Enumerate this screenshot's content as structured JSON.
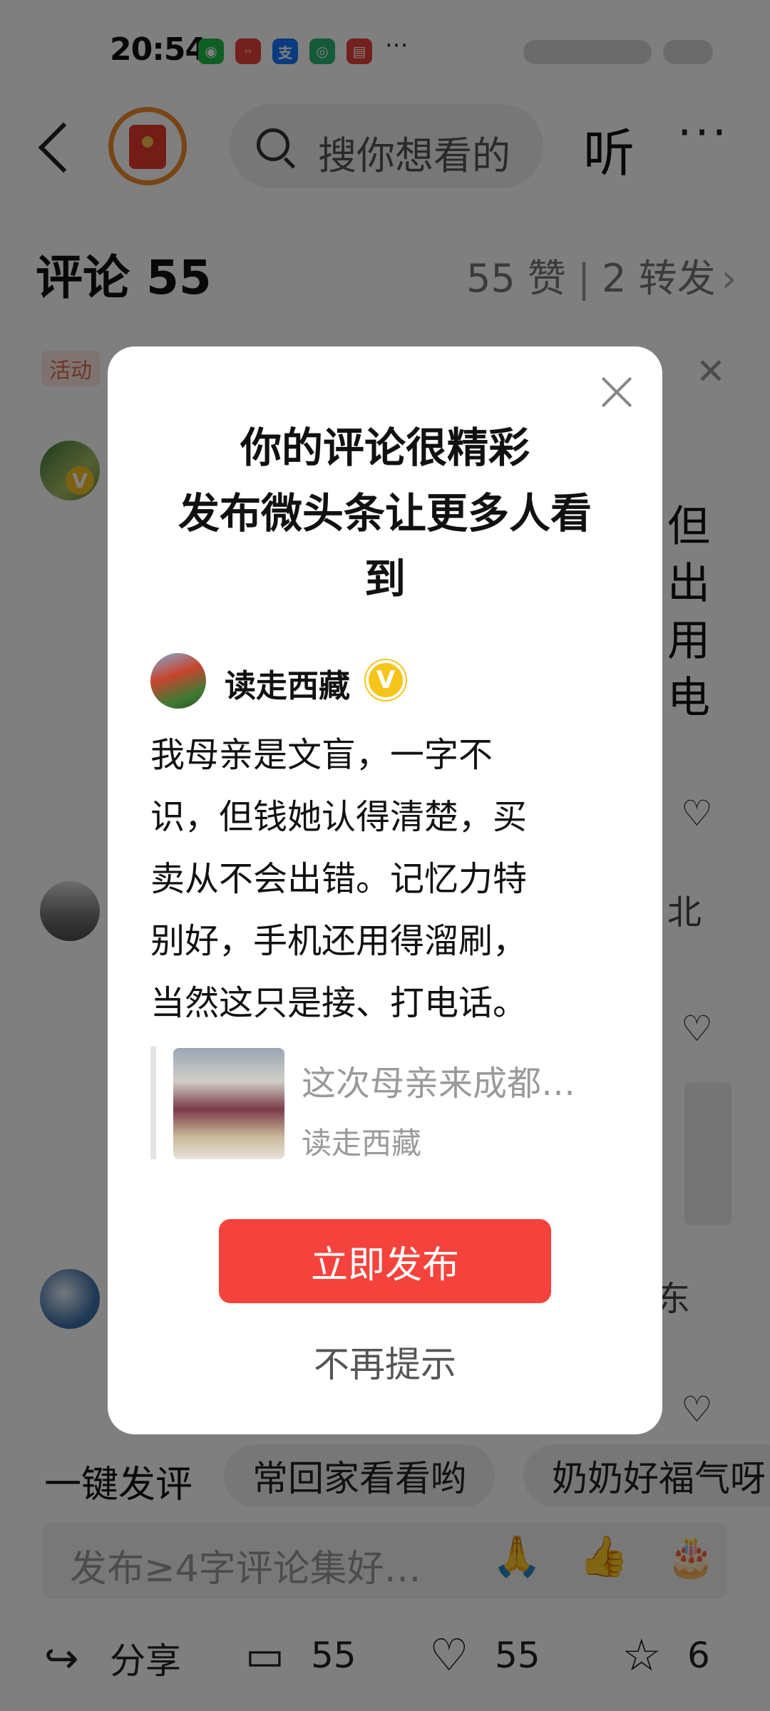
{
  "status_bar": {
    "time": "20:54",
    "app_icons": [
      "wechat-icon",
      "huawei-store-icon",
      "alipay-icon",
      "browser-icon",
      "mail-icon"
    ],
    "more": "···"
  },
  "header": {
    "search_placeholder": "搜你想看的",
    "listen_label": "听",
    "more_label": "···"
  },
  "comments": {
    "title": "评论 55",
    "likes": "55 赞",
    "sep": "|",
    "shares": "2 转发",
    "activity_tag": "活动",
    "bg_fragments": [
      "但",
      "出",
      "用",
      "电",
      "北",
      "东"
    ]
  },
  "quick_replies": {
    "label": "一键发评",
    "chips": [
      "常回家看看哟",
      "奶奶好福气呀"
    ]
  },
  "input": {
    "placeholder": "发布≥4字评论集好…",
    "emojis": [
      "🙏",
      "👍",
      "🎂"
    ]
  },
  "bottom_bar": {
    "share_label": "分享",
    "comment_count": "55",
    "like_count": "55",
    "favorite_count": "6"
  },
  "dialog": {
    "title_line1": "你的评论很精彩",
    "title_line2": "发布微头条让更多人看",
    "title_line3": "到",
    "author_name": "读走西藏",
    "verified_badge": "V",
    "body_lines": [
      "我母亲是文盲，一字不",
      "识，但钱她认得清楚，买",
      "卖从不会出错。记忆力特",
      "别好，手机还用得溜刷，",
      "当然这只是接、打电话。"
    ],
    "quote_title": "这次母亲来成都…",
    "quote_author": "读走西藏",
    "publish_button": "立即发布",
    "no_remind": "不再提示"
  },
  "colors": {
    "accent_red": "#f4433c",
    "verified_gold": "#f5c51c",
    "activity_tag_text": "#e36b4b"
  }
}
